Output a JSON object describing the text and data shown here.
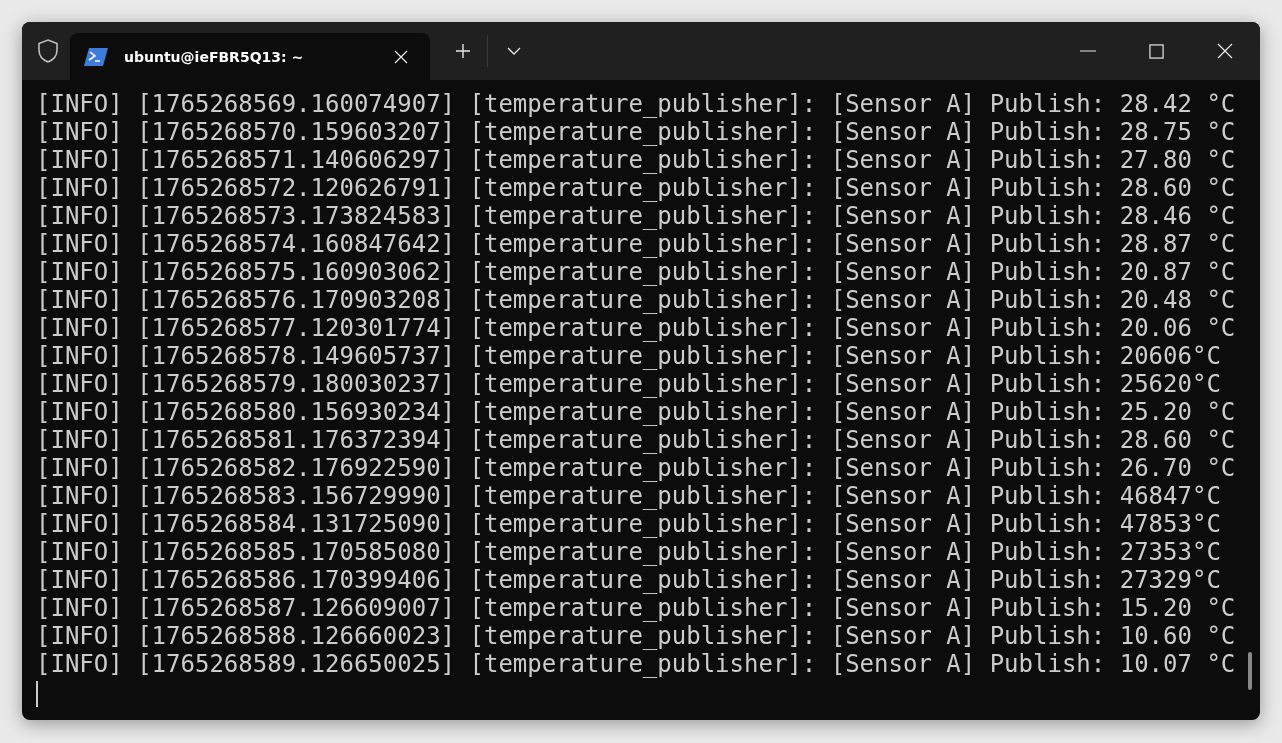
{
  "tabs": [
    {
      "label": "ubuntu@ieFBR5Q13: ~",
      "selected": true
    }
  ],
  "terminal": {
    "lines": [
      "[INFO] [1765268569.160074907] [temperature_publisher]: [Sensor A] Publish: 28.42 °C",
      "[INFO] [1765268570.159603207] [temperature_publisher]: [Sensor A] Publish: 28.75 °C",
      "[INFO] [1765268571.140606297] [temperature_publisher]: [Sensor A] Publish: 27.80 °C",
      "[INFO] [1765268572.120626791] [temperature_publisher]: [Sensor A] Publish: 28.60 °C",
      "[INFO] [1765268573.173824583] [temperature_publisher]: [Sensor A] Publish: 28.46 °C",
      "[INFO] [1765268574.160847642] [temperature_publisher]: [Sensor A] Publish: 28.87 °C",
      "[INFO] [1765268575.160903062] [temperature_publisher]: [Sensor A] Publish: 20.87 °C",
      "[INFO] [1765268576.170903208] [temperature_publisher]: [Sensor A] Publish: 20.48 °C",
      "[INFO] [1765268577.120301774] [temperature_publisher]: [Sensor A] Publish: 20.06 °C",
      "[INFO] [1765268578.149605737] [temperature_publisher]: [Sensor A] Publish: 20606°C",
      "[INFO] [1765268579.180030237] [temperature_publisher]: [Sensor A] Publish: 25620°C",
      "[INFO] [1765268580.156930234] [temperature_publisher]: [Sensor A] Publish: 25.20 °C",
      "[INFO] [1765268581.176372394] [temperature_publisher]: [Sensor A] Publish: 28.60 °C",
      "[INFO] [1765268582.176922590] [temperature_publisher]: [Sensor A] Publish: 26.70 °C",
      "[INFO] [1765268583.156729990] [temperature_publisher]: [Sensor A] Publish: 46847°C",
      "[INFO] [1765268584.131725090] [temperature_publisher]: [Sensor A] Publish: 47853°C",
      "[INFO] [1765268585.170585080] [temperature_publisher]: [Sensor A] Publish: 27353°C",
      "[INFO] [1765268586.170399406] [temperature_publisher]: [Sensor A] Publish: 27329°C",
      "[INFO] [1765268587.126609007] [temperature_publisher]: [Sensor A] Publish: 15.20 °C",
      "[INFO] [1765268588.126660023] [temperature_publisher]: [Sensor A] Publish: 10.60 °C",
      "[INFO] [1765268589.126650025] [temperature_publisher]: [Sensor A] Publish: 10.07 °C"
    ]
  }
}
